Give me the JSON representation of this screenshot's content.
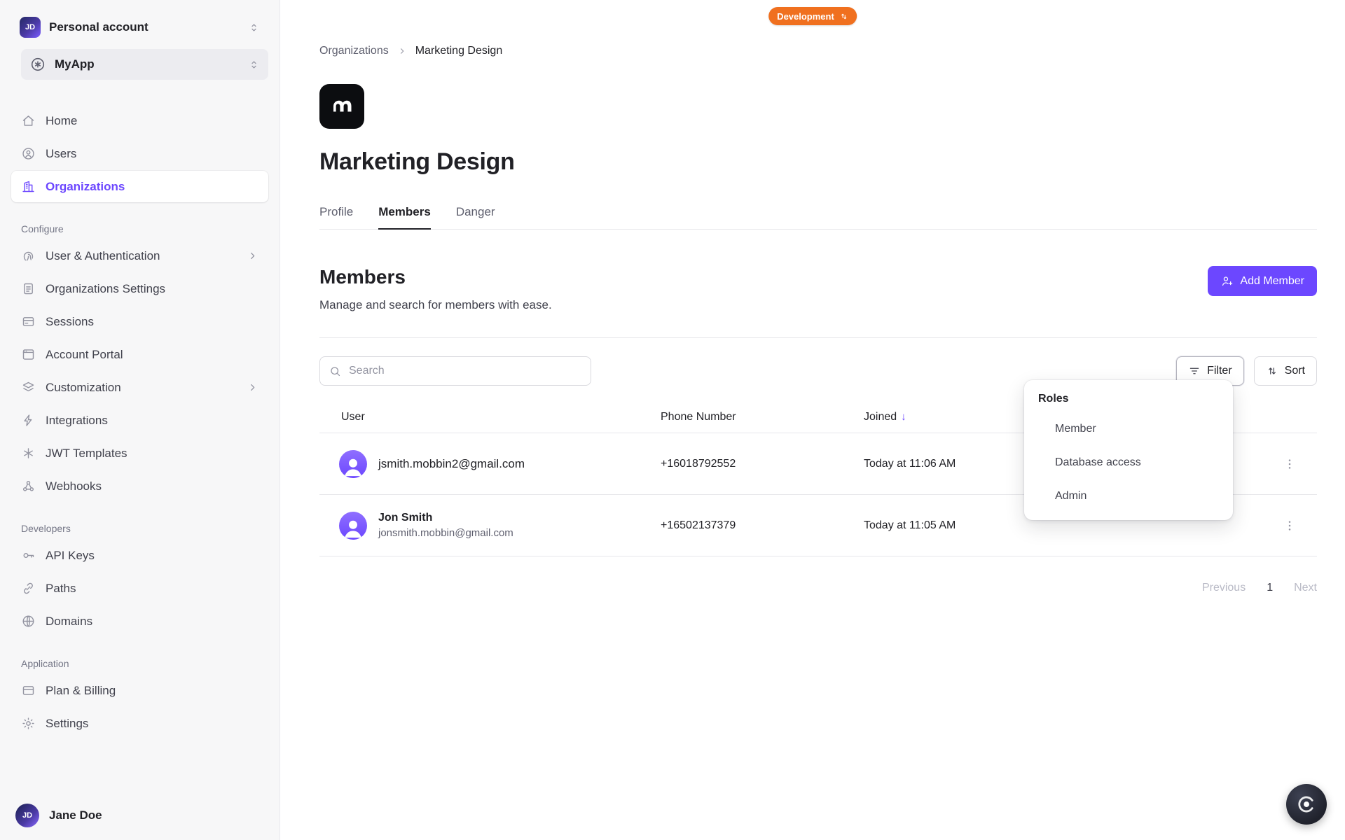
{
  "colors": {
    "accent": "#6c47ff",
    "badge_orange": "#f0701f",
    "sidebar_bg": "#f7f7f8",
    "fab_dark": "#20222c"
  },
  "sidebar": {
    "account_switcher": {
      "label": "Personal account",
      "avatar_initials": "JD"
    },
    "app_switcher": {
      "label": "MyApp"
    },
    "nav": [
      {
        "label": "Home"
      },
      {
        "label": "Users"
      },
      {
        "label": "Organizations"
      }
    ],
    "sections": [
      {
        "title": "Configure",
        "items": [
          {
            "label": "User & Authentication"
          },
          {
            "label": "Organizations Settings"
          },
          {
            "label": "Sessions"
          },
          {
            "label": "Account Portal"
          },
          {
            "label": "Customization"
          },
          {
            "label": "Integrations"
          },
          {
            "label": "JWT Templates"
          },
          {
            "label": "Webhooks"
          }
        ]
      },
      {
        "title": "Developers",
        "items": [
          {
            "label": "API Keys"
          },
          {
            "label": "Paths"
          },
          {
            "label": "Domains"
          }
        ]
      },
      {
        "title": "Application",
        "items": [
          {
            "label": "Plan & Billing"
          },
          {
            "label": "Settings"
          }
        ]
      }
    ],
    "footer_user": {
      "name": "Jane Doe",
      "avatar_initials": "JD"
    }
  },
  "header": {
    "environment_badge": "Development",
    "breadcrumb": {
      "parent": "Organizations",
      "current": "Marketing Design"
    }
  },
  "organization": {
    "name": "Marketing Design",
    "tabs": [
      {
        "label": "Profile"
      },
      {
        "label": "Members"
      },
      {
        "label": "Danger"
      }
    ]
  },
  "members": {
    "title": "Members",
    "subtitle": "Manage and search for members with ease.",
    "add_member_label": "Add Member",
    "search_placeholder": "Search",
    "filter_label": "Filter",
    "sort_label": "Sort",
    "columns": {
      "user": "User",
      "phone": "Phone Number",
      "joined": "Joined",
      "joined_sort_indicator": "↓"
    },
    "rows": [
      {
        "name": "",
        "email": "jsmith.mobbin2@gmail.com",
        "phone": "+16018792552",
        "joined": "Today at 11:06 AM"
      },
      {
        "name": "Jon Smith",
        "email": "jonsmith.mobbin@gmail.com",
        "phone": "+16502137379",
        "joined": "Today at 11:05 AM"
      }
    ],
    "roles_menu": {
      "title": "Roles",
      "options": [
        {
          "label": "Member"
        },
        {
          "label": "Database access"
        },
        {
          "label": "Admin"
        }
      ]
    },
    "pagination": {
      "previous": "Previous",
      "page": "1",
      "next": "Next"
    }
  }
}
